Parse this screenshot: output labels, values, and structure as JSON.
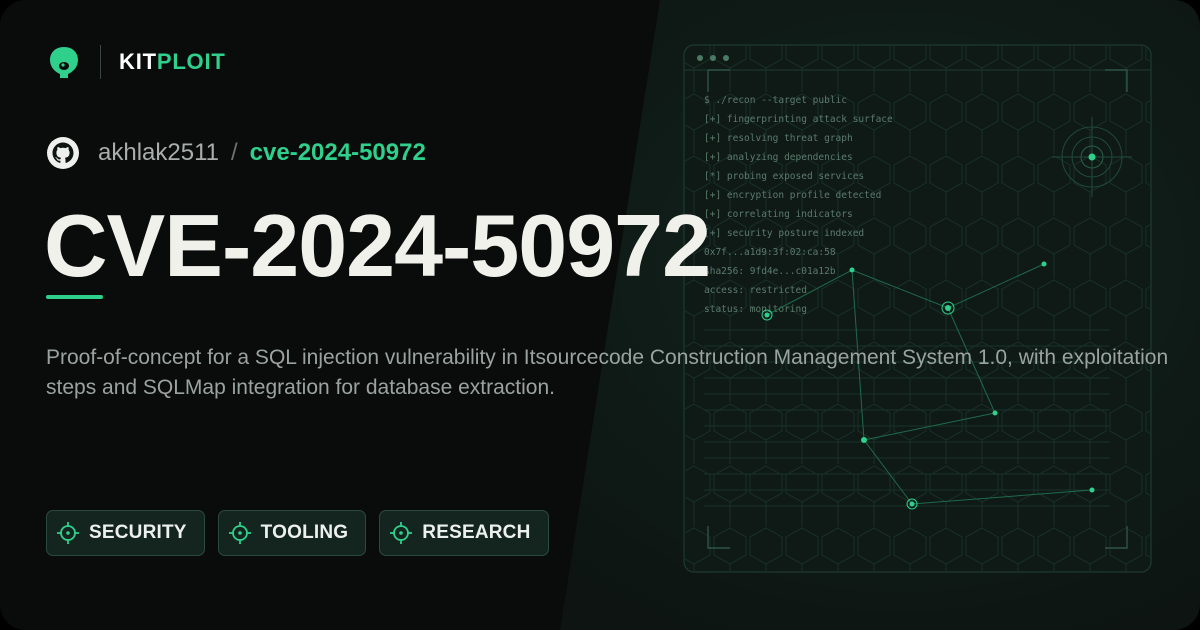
{
  "brand": {
    "name_part1": "KIT",
    "name_part2": "PLOIT",
    "logo_icon": "alien-head-logo-icon",
    "accent_color": "#2fcf8c"
  },
  "repo": {
    "icon": "github-icon",
    "owner": "akhlak2511",
    "separator": "/",
    "name": "cve-2024-50972"
  },
  "title": "CVE-2024-50972",
  "description": "Proof-of-concept for a SQL injection vulnerability in Itsourcecode Construction Management System 1.0, with exploitation steps and SQLMap integration for database extraction.",
  "tags": [
    {
      "label": "SECURITY",
      "icon": "crosshair-icon"
    },
    {
      "label": "TOOLING",
      "icon": "crosshair-icon"
    },
    {
      "label": "RESEARCH",
      "icon": "crosshair-icon"
    }
  ],
  "terminal": {
    "lines": [
      "$ ./recon --target public",
      "[+] fingerprinting attack surface",
      "[+] resolving threat graph",
      "[+] analyzing dependencies",
      "[*] probing exposed services",
      "[+] encryption profile detected",
      "[+] correlating indicators",
      "[+] security posture indexed",
      "0x7f...a1d9:3f:02:ca:58",
      "sha256: 9fd4e...c01a12b",
      "access: restricted",
      "status: monitoring"
    ]
  },
  "colors": {
    "background": "#0d1412",
    "title": "#f1f1ec",
    "text_muted": "#9aa3a0",
    "tag_background": "#14241e"
  }
}
